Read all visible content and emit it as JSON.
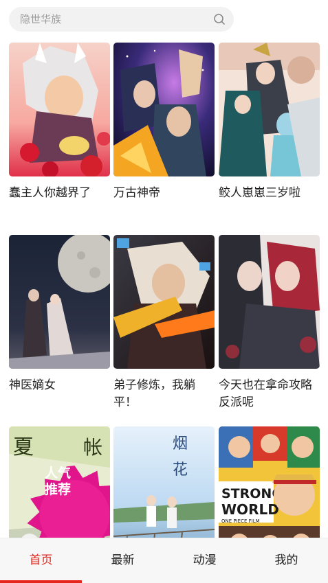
{
  "search": {
    "placeholder": "隐世华族"
  },
  "comics": [
    {
      "title": "蠢主人你越界了",
      "cover": "cover-white-haired-fox"
    },
    {
      "title": "万古神帝",
      "cover": "cover-galaxy-warrior"
    },
    {
      "title": "鲛人崽崽三岁啦",
      "cover": "cover-palace-family"
    },
    {
      "title": "神医嫡女",
      "cover": "cover-moonlit-couple"
    },
    {
      "title": "弟子修炼，我躺平！",
      "cover": "cover-flame-swordsman"
    },
    {
      "title": "今天也在拿命攻略反派呢",
      "cover": "cover-red-hair-pair"
    },
    {
      "title": "",
      "cover": "cover-calligraphy-green",
      "badge": "人气推荐"
    },
    {
      "title": "",
      "cover": "cover-railway-sky"
    },
    {
      "title": "",
      "cover": "cover-strong-world"
    }
  ],
  "cover_text": {
    "strong": "STRONG",
    "world": "WORLD",
    "op_film": "ONE PIECE FILM",
    "yan": "烟",
    "hua": "花"
  },
  "nav": {
    "items": [
      {
        "label": "首页",
        "active": true
      },
      {
        "label": "最新",
        "active": false
      },
      {
        "label": "动漫",
        "active": false
      },
      {
        "label": "我的",
        "active": false
      }
    ]
  },
  "colors": {
    "accent": "#e5261d",
    "badge": "#e0158c"
  }
}
